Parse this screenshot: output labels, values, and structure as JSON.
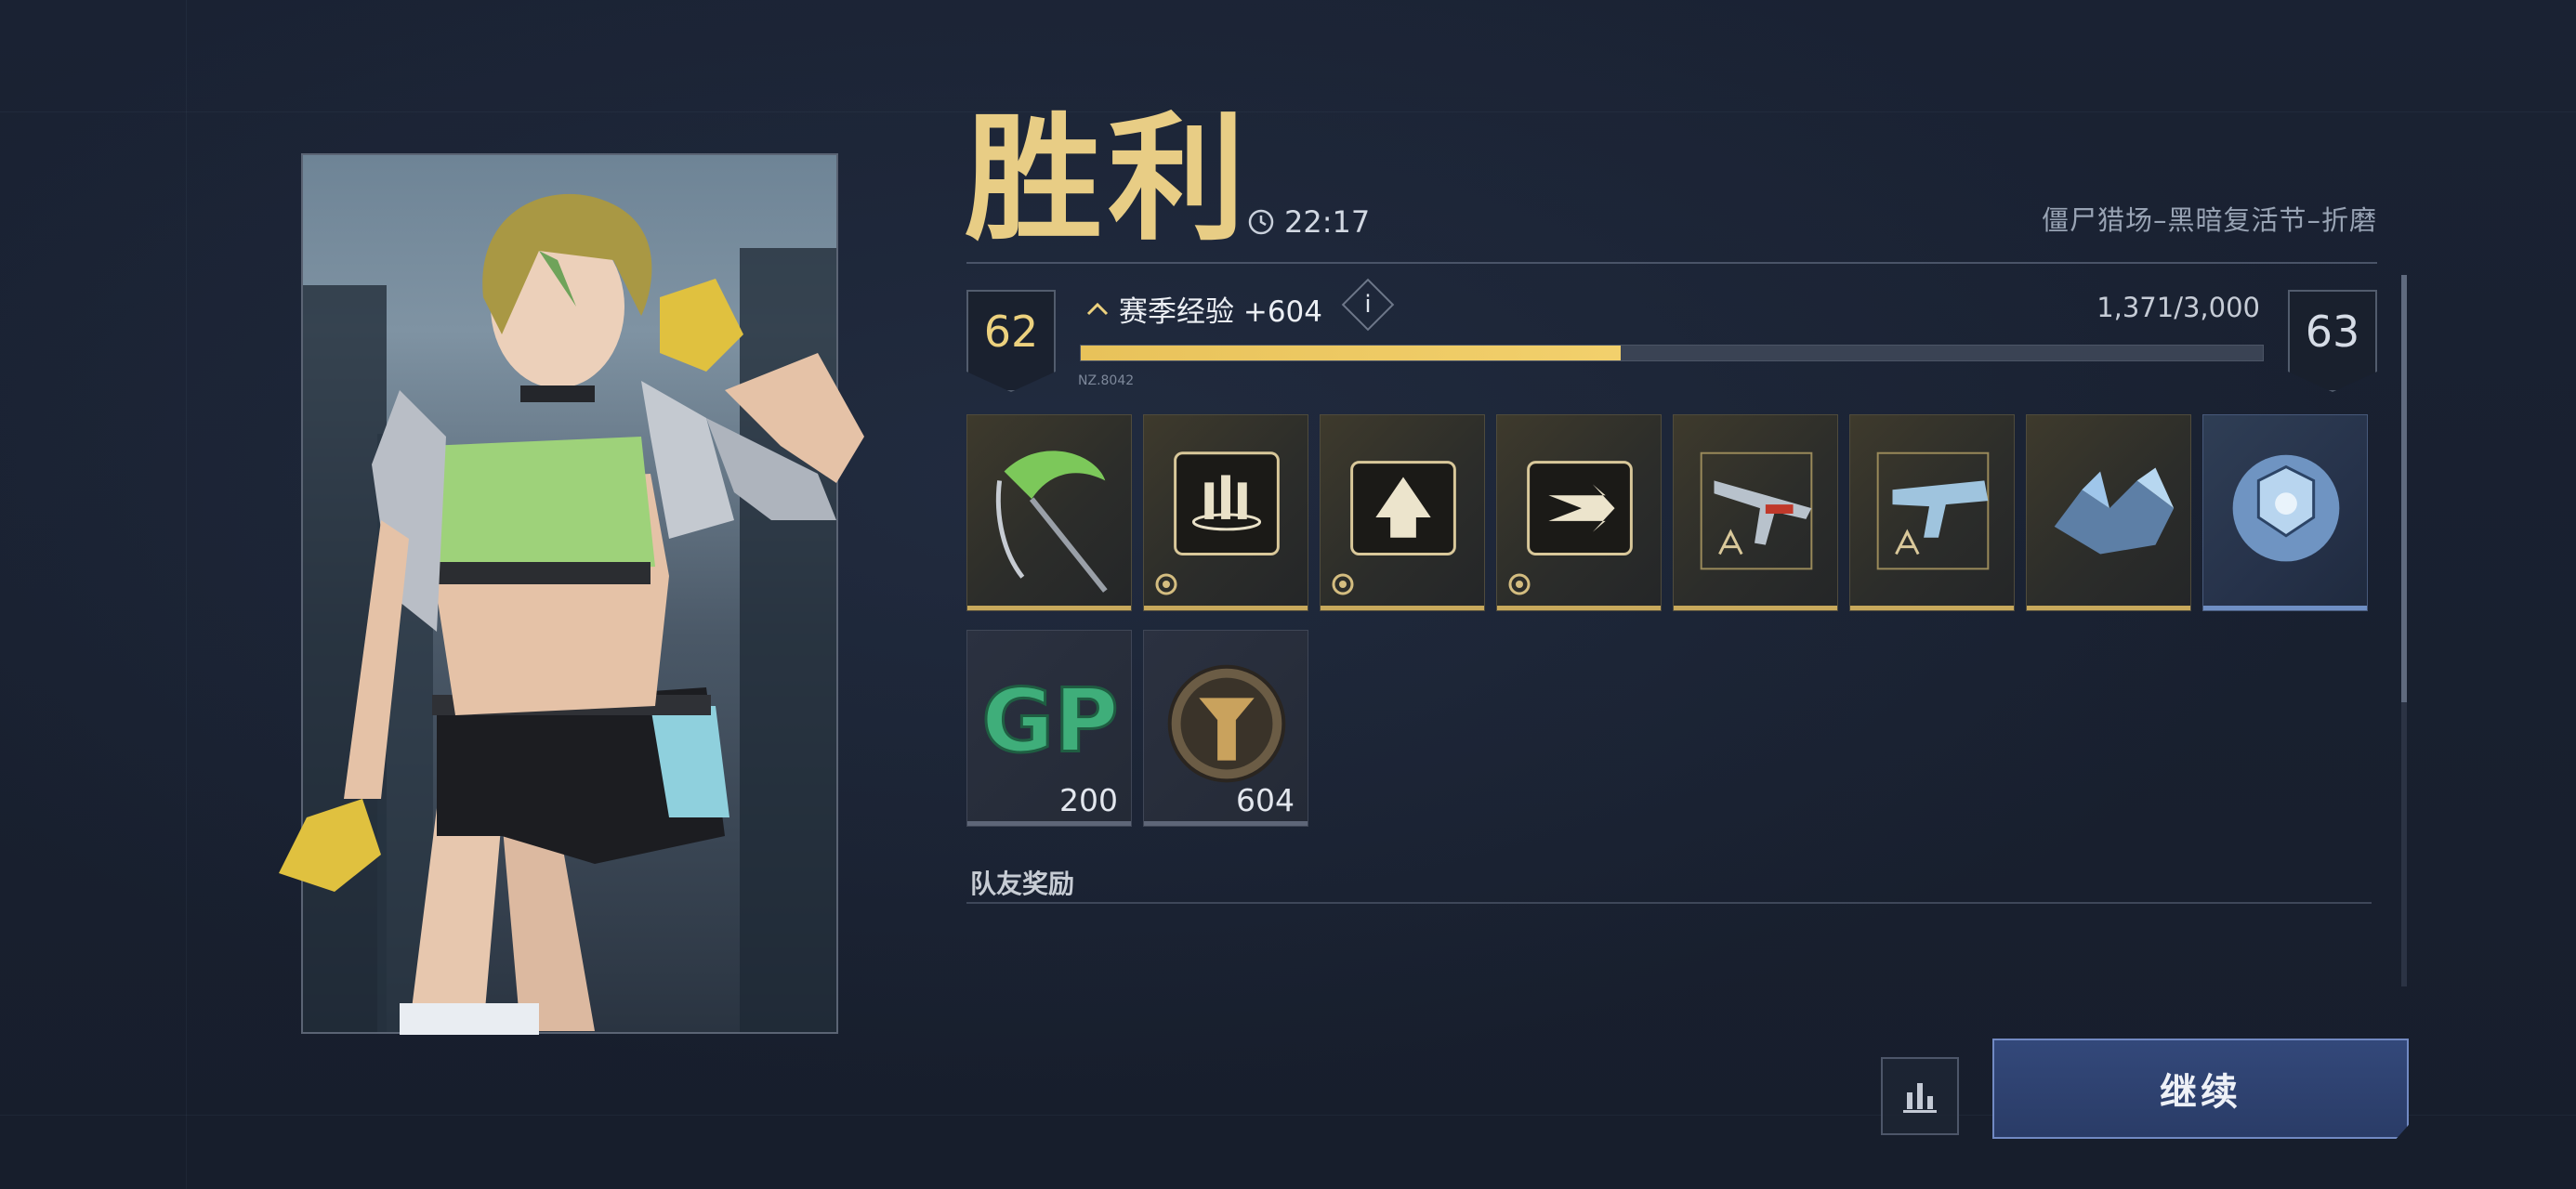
{
  "result": {
    "title": "胜利",
    "match_time": "22:17",
    "mode_name": "僵尸猎场–黑暗复活节–折磨"
  },
  "xp": {
    "current_level": "62",
    "next_level": "63",
    "label": "赛季经验 +604",
    "info_icon_label": "i",
    "progress_text": "1,371/3,000",
    "progress_value": 1371,
    "progress_max": 3000,
    "tiny_code": "NZ.8042"
  },
  "rewards": [
    {
      "name": "green-scythe",
      "icon": "scythe-icon",
      "style": "gold"
    },
    {
      "name": "ammo-folder",
      "icon": "ammo-icon",
      "style": "gold",
      "badge": true
    },
    {
      "name": "upgrade-folder",
      "icon": "arrow-up-icon",
      "style": "gold",
      "badge": true
    },
    {
      "name": "dash-folder",
      "icon": "dash-icon",
      "style": "gold",
      "badge": true
    },
    {
      "name": "rifle-blueprint",
      "icon": "rifle-icon",
      "style": "gold"
    },
    {
      "name": "pistol-blueprint",
      "icon": "pistol-icon",
      "style": "gold"
    },
    {
      "name": "crystal-shard",
      "icon": "crystal-icon",
      "style": "gold"
    },
    {
      "name": "ice-cube",
      "icon": "cube-icon",
      "style": "blue"
    },
    {
      "name": "gp-currency",
      "icon": "gp-icon",
      "style": "dark",
      "count": "200"
    },
    {
      "name": "badge-coin",
      "icon": "coin-icon",
      "style": "dark",
      "count": "604"
    }
  ],
  "gp_text": "GP",
  "teammate_rewards_label": "队友奖励",
  "buttons": {
    "continue_label": "继续"
  },
  "colors": {
    "accent_gold": "#e8cd85",
    "xp_bar": "#f2d06c",
    "button_blue": "#33487a"
  }
}
